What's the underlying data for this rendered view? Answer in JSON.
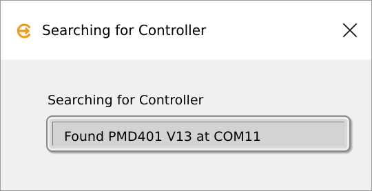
{
  "window": {
    "title": "Searching for Controller",
    "app_icon": "orange-circular-arrow-icon",
    "close_icon": "close-icon"
  },
  "content": {
    "label": "Searching for Controller",
    "status_value": "Found PMD401 V13 at COM11"
  },
  "colors": {
    "accent_icon": "#f39a1c",
    "title_bar": "#ffffff",
    "dialog_background": "#f0f0f0",
    "field_background": "#d3d3d3"
  }
}
